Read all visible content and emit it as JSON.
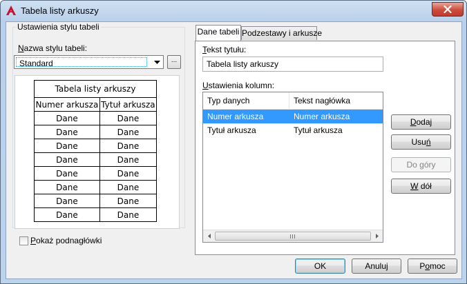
{
  "window": {
    "title": "Tabela listy arkuszy",
    "close_glyph": "✕",
    "accent_color": "#c13a2a"
  },
  "style_group": {
    "label": "Ustawienia stylu tabeli",
    "name_label_prefix": "",
    "name_label_underline": "N",
    "name_label_rest": "azwa stylu tabeli:",
    "combo_value": "Standard",
    "dots_button": "..."
  },
  "preview": {
    "title": "Tabela listy arkuszy",
    "headers": [
      "Numer arkusza",
      "Tytuł arkusza"
    ],
    "rows": [
      [
        "Dane",
        "Dane"
      ],
      [
        "Dane",
        "Dane"
      ],
      [
        "Dane",
        "Dane"
      ],
      [
        "Dane",
        "Dane"
      ],
      [
        "Dane",
        "Dane"
      ],
      [
        "Dane",
        "Dane"
      ],
      [
        "Dane",
        "Dane"
      ],
      [
        "Dane",
        "Dane"
      ]
    ]
  },
  "show_subheaders": {
    "underline": "P",
    "rest": "okaż podnagłówki",
    "checked": false
  },
  "tabs": [
    {
      "label": "Dane tabeli",
      "active": true
    },
    {
      "label": "Podzestawy i arkusze",
      "active": false
    }
  ],
  "title_field": {
    "label_underline": "T",
    "label_rest": "ekst tytułu:",
    "value": "Tabela listy arkuszy"
  },
  "columns": {
    "label_underline": "U",
    "label_rest": "stawienia kolumn:",
    "headers": [
      "Typ danych",
      "Tekst nagłówka"
    ],
    "rows": [
      {
        "type": "Numer arkusza",
        "header": "Numer arkusza",
        "selected": true
      },
      {
        "type": "Tytuł arkusza",
        "header": "Tytuł arkusza",
        "selected": false
      }
    ]
  },
  "side_buttons": {
    "add": {
      "u": "D",
      "rest": "odaj"
    },
    "remove": {
      "pre": "Usu",
      "u": "ń",
      "rest": ""
    },
    "up": {
      "label": "Do góry",
      "disabled": true
    },
    "down": {
      "u": "W",
      "rest": " dół"
    }
  },
  "footer": {
    "ok": "OK",
    "cancel": "Anuluj",
    "help_pre": "P",
    "help_u": "o",
    "help_rest": "moc"
  }
}
